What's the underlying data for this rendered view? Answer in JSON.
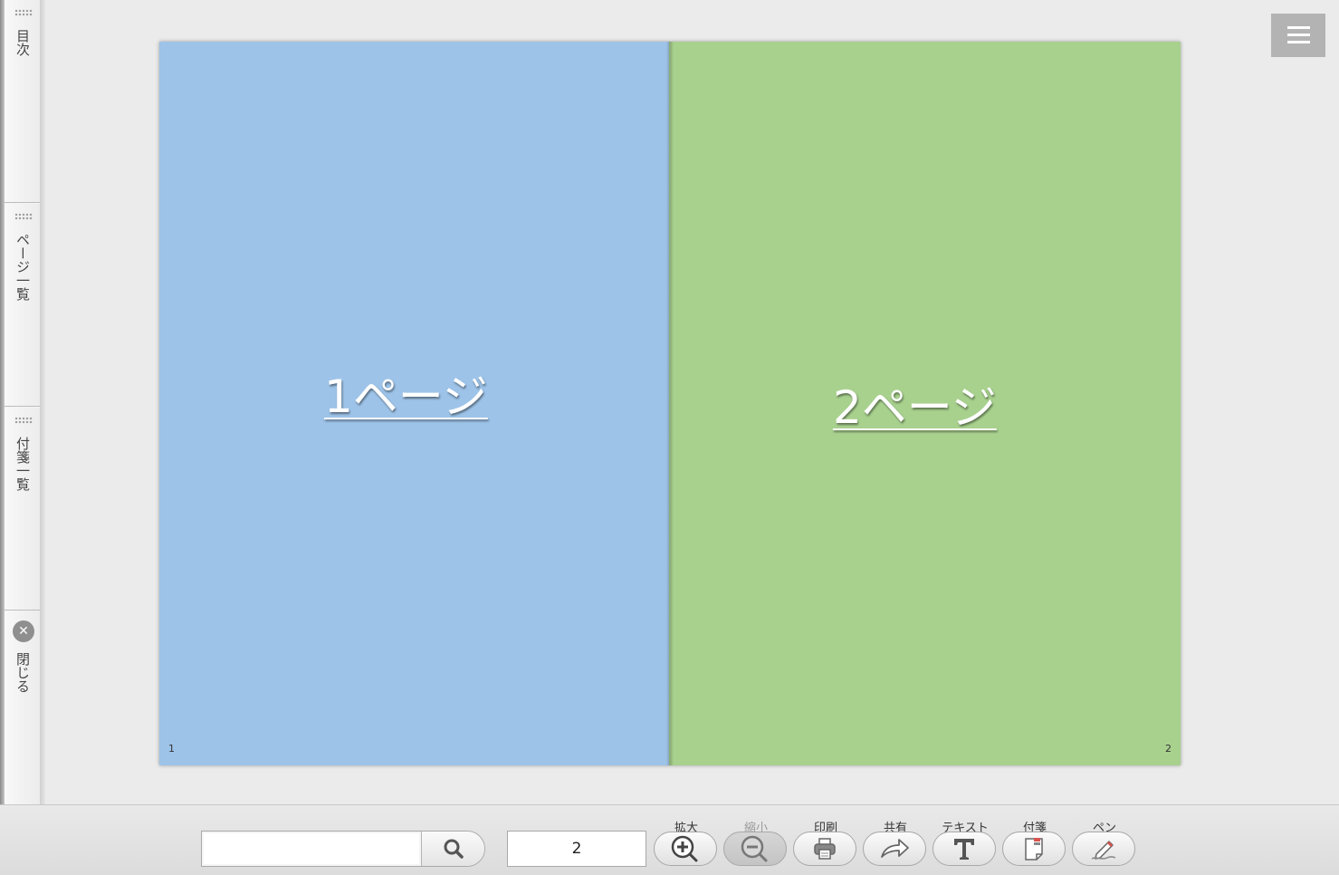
{
  "sidebar": {
    "tabs": [
      {
        "label": "目次"
      },
      {
        "label": "ページ一覧"
      },
      {
        "label": "付箋一覧"
      }
    ],
    "close_label": "閉じる",
    "close_icon": "close-icon"
  },
  "menu": {
    "icon": "hamburger-menu-icon"
  },
  "spread": {
    "left_page": {
      "title": "1ページ",
      "number": "1",
      "color": "#9dc3e8"
    },
    "right_page": {
      "title": "2ページ",
      "number": "2",
      "color": "#a8d18e"
    }
  },
  "toolbar": {
    "search": {
      "value": "",
      "placeholder": "",
      "icon": "search-icon"
    },
    "page_number": "2",
    "tools": [
      {
        "label": "拡大",
        "icon": "zoom-in-icon",
        "disabled": false
      },
      {
        "label": "縮小",
        "icon": "zoom-out-icon",
        "disabled": true
      },
      {
        "label": "印刷",
        "icon": "printer-icon",
        "disabled": false
      },
      {
        "label": "共有",
        "icon": "share-icon",
        "disabled": false
      },
      {
        "label": "テキスト",
        "icon": "text-icon",
        "disabled": false
      },
      {
        "label": "付箋",
        "icon": "sticky-note-icon",
        "disabled": false
      },
      {
        "label": "ペン",
        "icon": "pen-icon",
        "disabled": false
      }
    ]
  }
}
